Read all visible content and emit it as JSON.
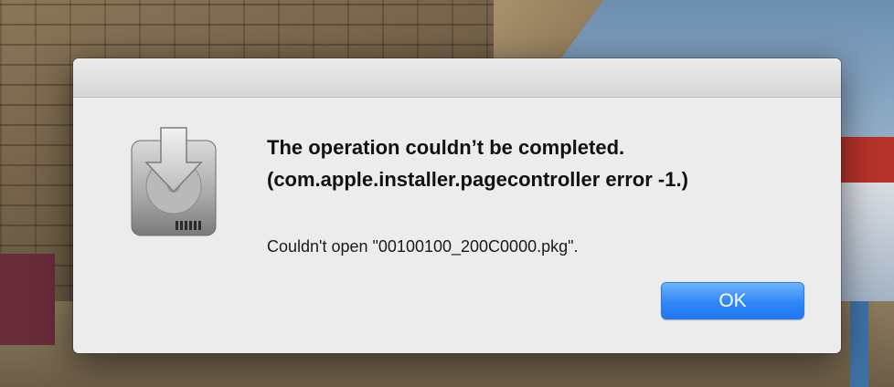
{
  "dialog": {
    "title": "The operation couldn’t be completed. (com.apple.installer.pagecontroller error -1.)",
    "message": "Couldn't open \"00100100_200C0000.pkg\".",
    "ok_label": "OK",
    "icon": "installer-disk-icon"
  },
  "colors": {
    "dialog_background": "#ececec",
    "button_blue": "#2f87f5",
    "button_text": "#ffffff"
  }
}
